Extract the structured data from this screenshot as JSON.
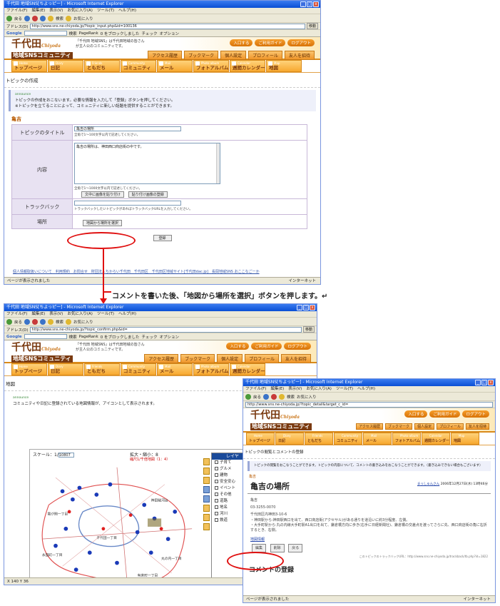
{
  "browser": {
    "title": "千代田 地域SNS[ちよっピー] - Microsoft Internet Explorer",
    "menu": [
      "ファイル(F)",
      "編集(E)",
      "表示(V)",
      "お気に入り(A)",
      "ツール(T)",
      "ヘルプ(H)"
    ],
    "toolbar": {
      "back": "戻る",
      "search": "検索",
      "favorites": "お気に入り"
    },
    "address_label": "アドレス(D)",
    "go_label": "移動",
    "google_label": "Google",
    "google_items": [
      "検索",
      "PageRank",
      "0 をブロックしました",
      "チェック",
      "オプション"
    ],
    "status_done": "ページが表示されました",
    "zone": "インターネット"
  },
  "site": {
    "logo_main": "千代田",
    "logo_en": "Chiyoda",
    "logo_sub": "地域SNSコミュニティ",
    "welcome": [
      "「千代田 地域SNS」は千代田地域の皆さん",
      "が主人公のコミュニティです。"
    ],
    "top_buttons": [
      "入口する",
      "ご利用ガイド",
      "ログアウト"
    ],
    "sub_nav": [
      "アクセス履歴",
      "ブックマーク",
      "個人設定",
      "プロフィール",
      "友人を招待"
    ],
    "main_nav": [
      {
        "en": "Home",
        "jp": "トップページ"
      },
      {
        "en": "Diary",
        "jp": "日記"
      },
      {
        "en": "Friends",
        "jp": "ともだち"
      },
      {
        "en": "Community",
        "jp": "コミュニティ"
      },
      {
        "en": "Mail",
        "jp": "メール"
      },
      {
        "en": "Photo album",
        "jp": "フォトアルバム"
      },
      {
        "en": "Calendar",
        "jp": "週間カレンダー"
      },
      {
        "en": "Map",
        "jp": "地図"
      }
    ]
  },
  "window1": {
    "url": "http://www.sns.ne-chiyoda.jp/?topic_input.php&id=100136",
    "page_title": "トピックの作成",
    "announce": "announce",
    "info_lines": [
      "トピックの作成をおこないます。必要な情報を入力して「登録」ボタンを押してください。",
      "※トピックを立てることによって、コミュニティに新しい話題を提供することができます。"
    ],
    "form_title": "亀吉",
    "rows": {
      "title_label": "トピックのタイトル",
      "title_value": "亀吉の場所",
      "title_hint": "全角で1～100文字以内で記述してください。",
      "content_label": "内容",
      "content_value": "亀吉の場所は、神田西口商店街の中です。",
      "content_hint": "全角で1～1000文字以内で記述してください。",
      "image_btn": "文中に画像を貼り付け",
      "upload_btn": "貼り付け画像の登録",
      "trackback_label": "トラックバック",
      "trackback_hint": "トラックバックしたいトピックがあればトラックバックURLを入力してください。",
      "place_label": "場所",
      "place_btn": "地図から場所を選択"
    },
    "submit": "登録",
    "footer": "個人情報取扱いについて　利用規約　お問合せ　財団法人ちからい千代田　千代田区　千代田区地域サイト[千代田dac.jp]　長岡地域SNS おここなごーか"
  },
  "caption": "コメントを書いた後、「地図から場所を選択」ボタンを押します。↵",
  "window2": {
    "url": "http://www.sns.ne-chiyoda.jp/?topic_confirm.php&id=",
    "page_title": "地図",
    "announce": "announce",
    "info": "コミュニティや日記に登録されている地図情報が、アイコンとして表示されます。",
    "scale_label": "スケール：1/",
    "scale_value": "10807",
    "zoom_label": "拡大・縮小：8",
    "zoom_note": "縮尺1/千倍地図（1：4）",
    "layer_title": "レイヤ",
    "layers": [
      "子育て",
      "グルメ",
      "建物",
      "安全安心",
      "イベント",
      "その他",
      "道路",
      "地名",
      "河川",
      "鉄道"
    ],
    "scale_bar": "0 0.2 0.4 0.6 0.8 mi",
    "status": "X 140 Y 36",
    "map_labels": [
      "霞が関一丁目",
      "永田町一丁目",
      "千代田一丁目",
      "有楽町一丁目",
      "神田駿河台",
      "丸の内一丁目"
    ]
  },
  "window3": {
    "url": "http://www.sns.ne-chiyoda.jp/?topic_detail&target_c_id=",
    "page_title": "トピックの閲覧とコメントの登録",
    "info": "トピックの閲覧をおこなうことができます。トピックの内容について、コメントの書き込みをおこなうことができます。（書き込みできない場合もございます）",
    "community": "亀吉",
    "topic_title": "亀吉の場所",
    "author": "まっしゅんさん",
    "date": "2006年12月27日(水) 13時46分",
    "body_lines": [
      "亀吉",
      "03-3255-0070",
      "千代田区内神田3-10-6",
      "・神田駅から:神田駅西口を出て、西口商店街(アクセサル)がある通りを道沿いに約3分程度、左側。",
      "・大手町駅から:丸の内線大手町駅A1出口を出て、鎌倉橋方向に歩き(右手に日経新聞社)、鎌倉橋の交差点を渡ってさらに先、西口商店街の角に右折するとき、右側。"
    ],
    "map_link": "地図情報",
    "btn_edit": "編集",
    "btn_delete": "削除",
    "btn_back": "戻る",
    "trackback_url": "このトピックのトラックバックURL：http://www.sns.ne-chiyoda.jp/trackback/tb.php?id=1822",
    "comment_title": "コメントの登録",
    "status": "ページが表示されました"
  }
}
